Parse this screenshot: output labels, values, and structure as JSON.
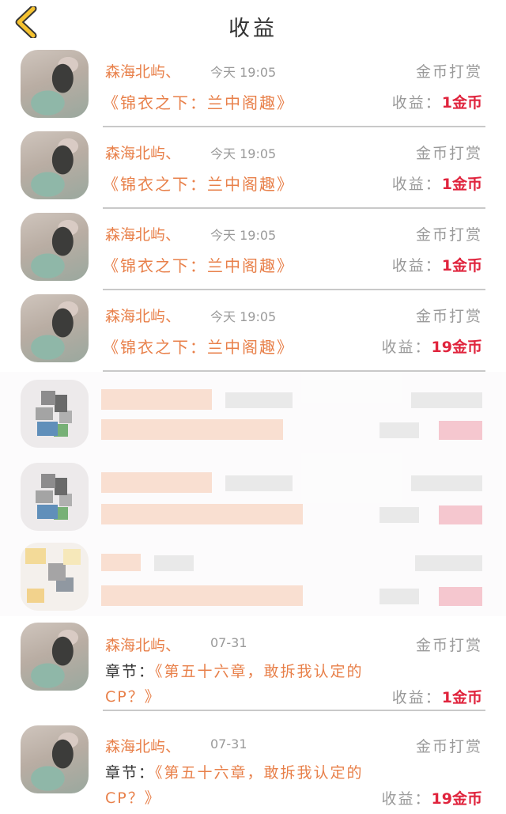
{
  "header": {
    "title": "收益",
    "back_icon": "chevron-left-icon"
  },
  "records": [
    {
      "user": "森海北屿、",
      "time": "今天 19:05",
      "type": "金币打赏",
      "work": "《锦衣之下：兰中阁趣》",
      "income_label": "收益：",
      "income_value": "1金币"
    },
    {
      "user": "森海北屿、",
      "time": "今天 19:05",
      "type": "金币打赏",
      "work": "《锦衣之下：兰中阁趣》",
      "income_label": "收益：",
      "income_value": "1金币"
    },
    {
      "user": "森海北屿、",
      "time": "今天 19:05",
      "type": "金币打赏",
      "work": "《锦衣之下：兰中阁趣》",
      "income_label": "收益：",
      "income_value": "1金币"
    },
    {
      "user": "森海北屿、",
      "time": "今天 19:05",
      "type": "金币打赏",
      "work": "《锦衣之下：兰中阁趣》",
      "income_label": "收益：",
      "income_value": "19金币"
    },
    {
      "user": "森海北屿、",
      "time": "07-31",
      "type": "金币打赏",
      "chapter_label": "章节：",
      "chapter_text": "《第五十六章，敢拆我认定的CP？》",
      "income_label": "收益：",
      "income_value": "1金币"
    },
    {
      "user": "森海北屿、",
      "time": "07-31",
      "type": "金币打赏",
      "chapter_label": "章节：",
      "chapter_text": "《第五十六章，敢拆我认定的CP？》",
      "income_label": "收益：",
      "income_value": "19金币"
    }
  ],
  "colors": {
    "accent": "#e8804a",
    "income": "#e0243d",
    "muted": "#9a9a9a"
  }
}
